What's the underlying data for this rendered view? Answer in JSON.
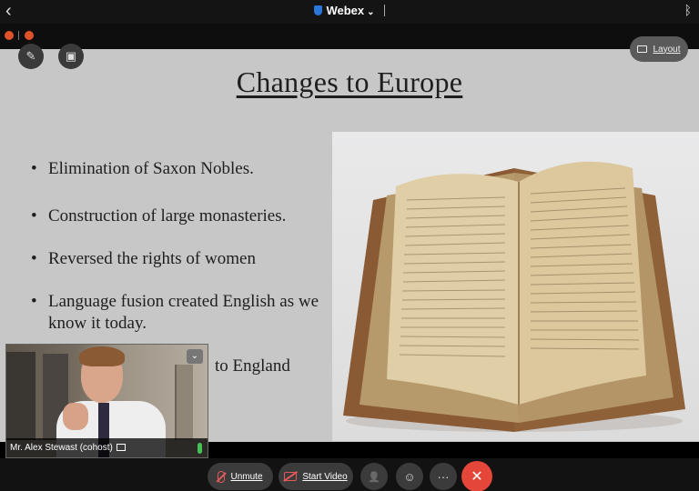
{
  "top_bar": {
    "app_name": "Webex",
    "back_glyph": "‹",
    "chevron_glyph": "⌄",
    "bluetooth_glyph": "ᛒ"
  },
  "floating_controls": {
    "layout_label": "Layout"
  },
  "slide": {
    "title": "Changes to Europe",
    "bullets": [
      "Elimination of Saxon Nobles.",
      "Construction of large monasteries.",
      "Reversed the rights of women",
      "Language fusion created English as we know it today.",
      "to England"
    ]
  },
  "self_view": {
    "participant_name": "Mr. Alex Stewast (cohost)",
    "chevron_glyph": "⌄"
  },
  "controls": {
    "unmute_label": "Unmute",
    "start_video_label": "Start Video",
    "more_glyph": "···",
    "end_glyph": "✕",
    "participants_glyph": "👤",
    "reactions_glyph": "☺"
  },
  "colors": {
    "accent_red": "#e5463a",
    "webex_blue": "#2b76d9",
    "slide_bg": "#c7c7c7"
  }
}
